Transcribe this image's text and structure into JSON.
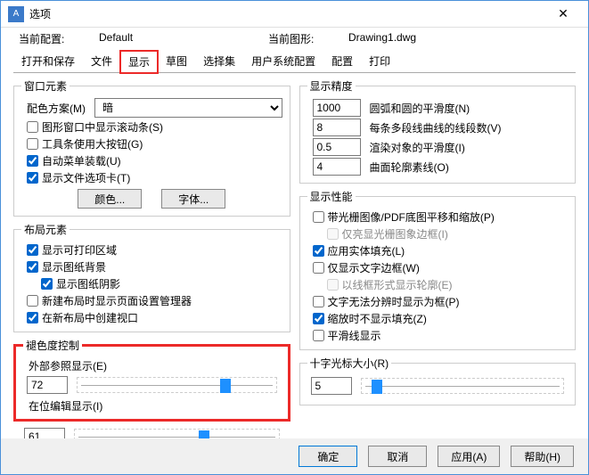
{
  "window": {
    "title": "选项",
    "close": "✕"
  },
  "info": {
    "configLbl": "当前配置:",
    "configVal": "Default",
    "drawingLbl": "当前图形:",
    "drawingVal": "Drawing1.dwg"
  },
  "tabs": [
    "打开和保存",
    "文件",
    "显示",
    "草图",
    "选择集",
    "用户系统配置",
    "配置",
    "打印"
  ],
  "left": {
    "windowElem": {
      "legend": "窗口元素",
      "schemeLbl": "配色方案(M)",
      "schemeVal": "暗",
      "scroll": "图形窗口中显示滚动条(S)",
      "bigBtn": "工具条使用大按钮(G)",
      "autoMenu": "自动菜单装载(U)",
      "fileTab": "显示文件选项卡(T)",
      "colorBtn": "颜色...",
      "fontBtn": "字体..."
    },
    "layoutElem": {
      "legend": "布局元素",
      "printArea": "显示可打印区域",
      "paperBg": "显示图纸背景",
      "paperShadow": "显示图纸阴影",
      "newLayout": "新建布局时显示页面设置管理器",
      "viewport": "在新布局中创建视口"
    },
    "fade": {
      "legend": "褪色度控制",
      "xrefLbl": "外部参照显示(E)",
      "xrefVal": "72",
      "editLbl": "在位编辑显示(I)",
      "editVal": "61"
    }
  },
  "right": {
    "precision": {
      "legend": "显示精度",
      "arc": {
        "val": "1000",
        "lbl": "圆弧和圆的平滑度(N)"
      },
      "poly": {
        "val": "8",
        "lbl": "每条多段线曲线的线段数(V)"
      },
      "surf": {
        "val": "0.5",
        "lbl": "渲染对象的平滑度(I)"
      },
      "contour": {
        "val": "4",
        "lbl": "曲面轮廓素线(O)"
      }
    },
    "perf": {
      "legend": "显示性能",
      "raster": "带光栅图像/PDF底图平移和缩放(P)",
      "hlFrame": "仅亮显光栅图象边框(I)",
      "solidFill": "应用实体填充(L)",
      "textFrame": "仅显示文字边框(W)",
      "wireframe": "以线框形式显示轮廓(E)",
      "textblk": "文字无法分辨时显示为框(P)",
      "zoomFill": "缩放时不显示填充(Z)",
      "smooth": "平滑线显示"
    },
    "cross": {
      "legend": "十字光标大小(R)",
      "val": "5"
    }
  },
  "footer": {
    "ok": "确定",
    "cancel": "取消",
    "apply": "应用(A)",
    "help": "帮助(H)"
  }
}
